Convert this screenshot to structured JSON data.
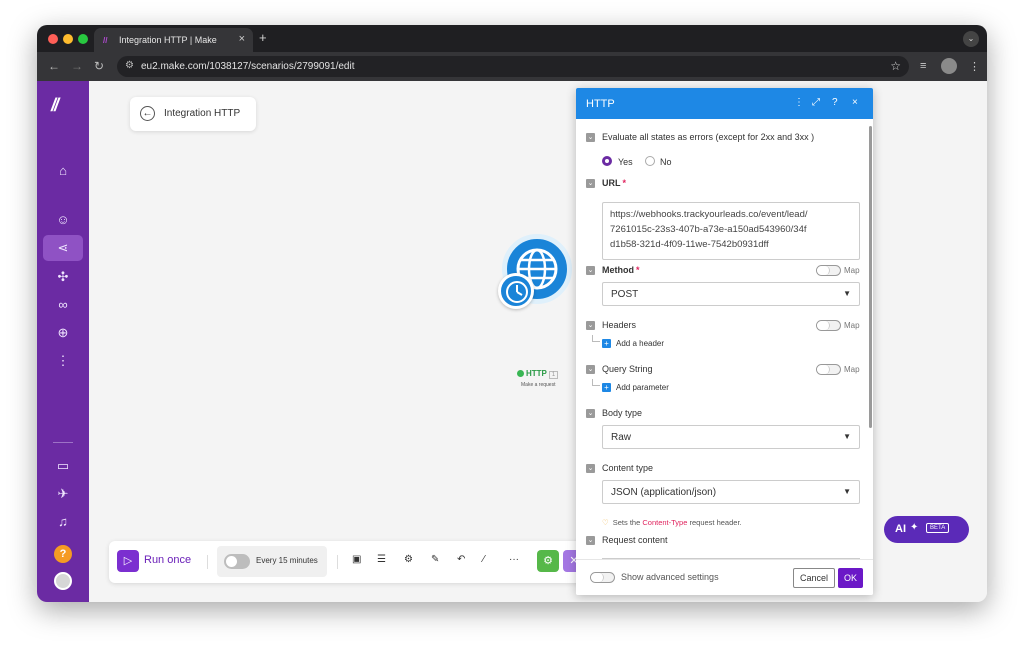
{
  "browser": {
    "tab_title": "Integration HTTP | Make",
    "tab_favicon": "//",
    "new_tab": "+",
    "url": "eu2.make.com/1038127/scenarios/2799091/edit"
  },
  "sidebar": {
    "logo": "//",
    "items": [
      "home-icon",
      "team-icon",
      "scenarios-icon",
      "apps-icon",
      "connections-icon",
      "webhooks-icon",
      "more-icon"
    ],
    "bottom_items": [
      "docs-icon",
      "launch-icon",
      "notifications-icon"
    ],
    "help_label": "?"
  },
  "canvas": {
    "back_label": "Integration HTTP",
    "module": {
      "name": "HTTP",
      "index": "1",
      "subtitle": "Make a request",
      "color": "#1a84d8"
    }
  },
  "toolbar": {
    "run_label": "Run once",
    "schedule_label": "Every 15 minutes",
    "more": "···"
  },
  "ai_button": {
    "label": "AI",
    "badge": "BETA"
  },
  "panel": {
    "title": "HTTP",
    "header_color": "#1e88e5",
    "evaluate_label": "Evaluate all states as errors (except for 2xx and 3xx )",
    "yes_label": "Yes",
    "no_label": "No",
    "url_label": "URL",
    "required_mark": "*",
    "url_lines": [
      "https://webhooks.trackyourleads.co/event/lead/",
      "7261015c-23s3-407b-a73e-a150ad543960/34f",
      "d1b58-321d-4f09-11we-7542b0931dff"
    ],
    "method_label": "Method",
    "method_value": "POST",
    "map_label": "Map",
    "headers_label": "Headers",
    "add_header": "Add a header",
    "query_label": "Query String",
    "add_parameter": "Add parameter",
    "body_type_label": "Body type",
    "body_type_value": "Raw",
    "content_type_label": "Content type",
    "content_type_value": "JSON (application/json)",
    "hint_prefix": "Sets the",
    "hint_code": "Content-Type",
    "hint_suffix": "request header.",
    "request_content_label": "Request content",
    "advanced_label": "Show advanced settings",
    "cancel_label": "Cancel",
    "ok_label": "OK"
  }
}
